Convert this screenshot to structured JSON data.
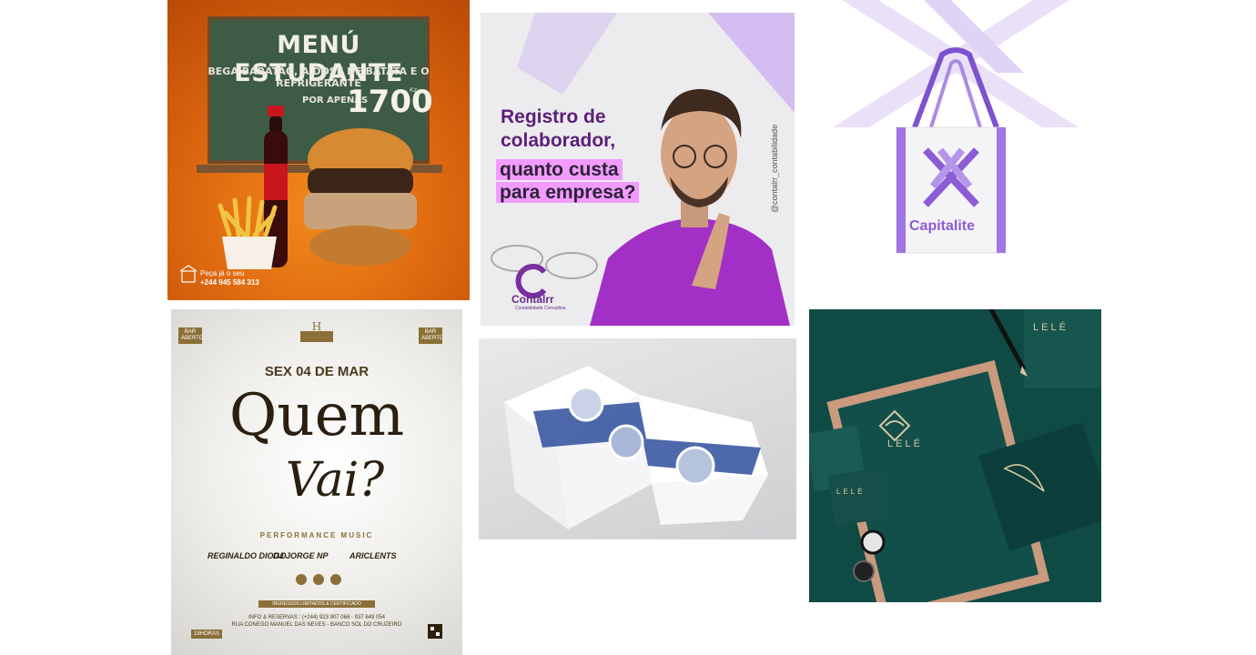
{
  "tiles": {
    "menu": {
      "title": "MENÚ ESTUDANTE",
      "subtitle": "BEGA BARATÃO, A DOSE DE BATATA E O REFRIGERANTE",
      "por_apenas": "POR APENAS",
      "price": "1700",
      "currency": "Kz",
      "phone_label": "Peça já o seu",
      "phone": "+244 945 584 313",
      "colors": {
        "bg": "#e06a10",
        "board": "#3d5b45"
      }
    },
    "accounting": {
      "headline_line1": "Registro de",
      "headline_line2": "colaborador,",
      "headline_line3": "quanto custa",
      "headline_line4": "para empresa?",
      "handle": "@contalrr_contabilidade",
      "brand": "Contalrr",
      "brand_tag": "Contabilidade Consultiva",
      "colors": {
        "accent": "#5b1f78",
        "highlight": "#f29bff"
      }
    },
    "bag": {
      "brand": "Capitalite",
      "colors": {
        "purple": "#8c5bd6",
        "light": "#d9c9f5"
      }
    },
    "event": {
      "bar_left": "BAR ABERTO",
      "bar_right": "BAR ABERTO",
      "date": "SEX 04 DE MAR",
      "headline1": "Quem",
      "headline2": "Vai?",
      "performance": "PERFORMANCE MUSIC",
      "djs": [
        "REGINALDO DIOGO",
        "DJ JORGE NP",
        "ARICLENTS"
      ],
      "ingressos": "INGRESSOS LIMITADOS & CERTIFICADO OBRIGATÓRIO",
      "info": "INFO & RESERVAS : (+244) 923 907 068 - 937 649 054",
      "address": "RUA CONEGO MANUEL DAS NEVES - BANCO SOL DO CRUZEIRO",
      "hours": "18HORAS",
      "colors": {
        "gold": "#8b6f38"
      }
    },
    "brochure": {
      "colors": {
        "blue": "#2e4f9c",
        "paper": "#ffffff"
      }
    },
    "stationery": {
      "brand": "LELÉ",
      "colors": {
        "green": "#0f4a45",
        "gold": "#d9c6a3",
        "copper": "#c99a7e"
      }
    }
  }
}
